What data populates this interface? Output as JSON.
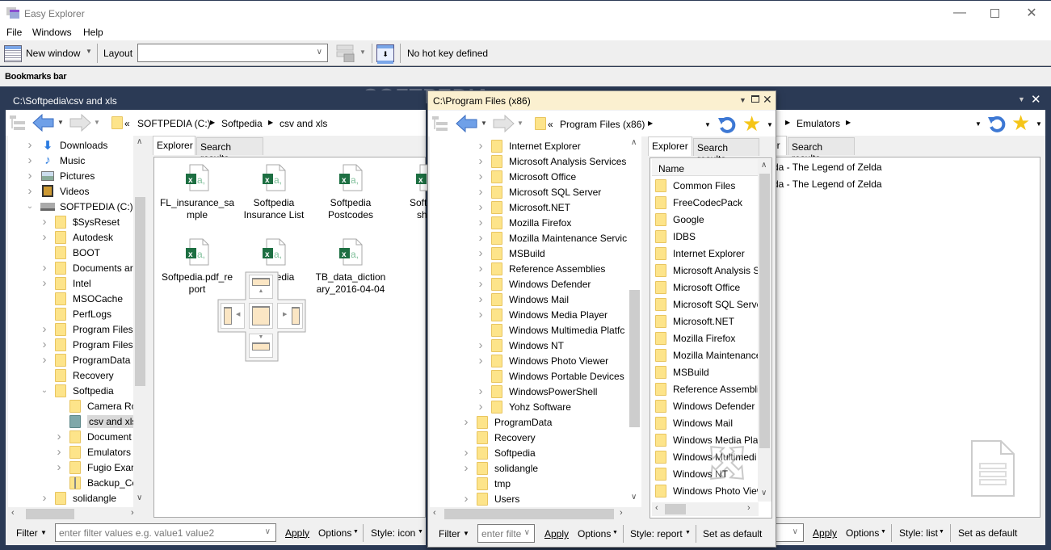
{
  "app": {
    "title": "Easy Explorer"
  },
  "menu": [
    "File",
    "Windows",
    "Help"
  ],
  "toolbar": {
    "new_window": "New window",
    "layout_label": "Layout",
    "layout_value": "",
    "hotkey": "No hot key defined"
  },
  "bookmarks_bar": "Bookmarks bar",
  "watermark": "SOFTPEDIA",
  "left_pane": {
    "title": "C:\\Softpedia\\csv and xls",
    "breadcrumb": [
      "«",
      "SOFTPEDIA (C:)",
      "Softpedia",
      "csv and xls"
    ],
    "tabs": [
      "Explorer",
      "Search results"
    ],
    "tree": [
      {
        "label": "Downloads",
        "level": 1,
        "expand": "collapsed",
        "icon": "download-icon"
      },
      {
        "label": "Music",
        "level": 1,
        "expand": "collapsed",
        "icon": "music-icon"
      },
      {
        "label": "Pictures",
        "level": 1,
        "expand": "collapsed",
        "icon": "pictures-icon"
      },
      {
        "label": "Videos",
        "level": 1,
        "expand": "collapsed",
        "icon": "videos-icon"
      },
      {
        "label": "SOFTPEDIA (C:)",
        "level": 1,
        "expand": "expanded",
        "icon": "drive-icon"
      },
      {
        "label": "$SysReset",
        "level": 2,
        "expand": "collapsed"
      },
      {
        "label": "Autodesk",
        "level": 2,
        "expand": "collapsed"
      },
      {
        "label": "BOOT",
        "level": 2,
        "expand": "none"
      },
      {
        "label": "Documents ar",
        "level": 2,
        "expand": "collapsed",
        "shortcut": true
      },
      {
        "label": "Intel",
        "level": 2,
        "expand": "collapsed"
      },
      {
        "label": "MSOCache",
        "level": 2,
        "expand": "none"
      },
      {
        "label": "PerfLogs",
        "level": 2,
        "expand": "none"
      },
      {
        "label": "Program Files",
        "level": 2,
        "expand": "collapsed"
      },
      {
        "label": "Program Files",
        "level": 2,
        "expand": "collapsed"
      },
      {
        "label": "ProgramData",
        "level": 2,
        "expand": "collapsed"
      },
      {
        "label": "Recovery",
        "level": 2,
        "expand": "none"
      },
      {
        "label": "Softpedia",
        "level": 2,
        "expand": "expanded"
      },
      {
        "label": "Camera Rc",
        "level": 3,
        "expand": "none"
      },
      {
        "label": "csv and xls",
        "level": 3,
        "expand": "none",
        "selected": true
      },
      {
        "label": "Document",
        "level": 3,
        "expand": "collapsed"
      },
      {
        "label": "Emulators",
        "level": 3,
        "expand": "collapsed"
      },
      {
        "label": "Fugio Exar",
        "level": 3,
        "expand": "collapsed"
      },
      {
        "label": "Backup_Cc",
        "level": 3,
        "expand": "none",
        "zip": true
      },
      {
        "label": "solidangle",
        "level": 2,
        "expand": "collapsed"
      }
    ],
    "files": [
      {
        "label1": "FL_insurance_sa",
        "label2": "mple"
      },
      {
        "label1": "Softpedia",
        "label2": "Insurance List"
      },
      {
        "label1": "Softpedia",
        "label2": "Postcodes"
      },
      {
        "label1": "Softpedi",
        "label2": "shee"
      },
      {
        "label1": "Softpedia.pdf_re",
        "label2": "port"
      },
      {
        "label1": "Softpedia",
        "label2": ""
      },
      {
        "label1": "TB_data_diction",
        "label2": "ary_2016-04-04"
      }
    ],
    "filter": {
      "label": "Filter",
      "placeholder": "enter filter values e.g. value1 value2",
      "apply": "Apply",
      "options": "Options",
      "style": "Style: icon"
    }
  },
  "middle_pane": {
    "title": "C:\\Program Files (x86)",
    "breadcrumb": [
      "«",
      "Program Files (x86)"
    ],
    "tabs": [
      "Explorer",
      "Search results"
    ],
    "tree": [
      {
        "label": "Internet Explorer",
        "level": 2,
        "expand": "collapsed"
      },
      {
        "label": "Microsoft Analysis Services",
        "level": 2,
        "expand": "collapsed"
      },
      {
        "label": "Microsoft Office",
        "level": 2,
        "expand": "collapsed"
      },
      {
        "label": "Microsoft SQL Server",
        "level": 2,
        "expand": "collapsed"
      },
      {
        "label": "Microsoft.NET",
        "level": 2,
        "expand": "collapsed"
      },
      {
        "label": "Mozilla Firefox",
        "level": 2,
        "expand": "collapsed"
      },
      {
        "label": "Mozilla Maintenance Servic",
        "level": 2,
        "expand": "collapsed"
      },
      {
        "label": "MSBuild",
        "level": 2,
        "expand": "collapsed"
      },
      {
        "label": "Reference Assemblies",
        "level": 2,
        "expand": "collapsed"
      },
      {
        "label": "Windows Defender",
        "level": 2,
        "expand": "collapsed"
      },
      {
        "label": "Windows Mail",
        "level": 2,
        "expand": "collapsed"
      },
      {
        "label": "Windows Media Player",
        "level": 2,
        "expand": "collapsed"
      },
      {
        "label": "Windows Multimedia Platfc",
        "level": 2,
        "expand": "none"
      },
      {
        "label": "Windows NT",
        "level": 2,
        "expand": "collapsed"
      },
      {
        "label": "Windows Photo Viewer",
        "level": 2,
        "expand": "collapsed"
      },
      {
        "label": "Windows Portable Devices",
        "level": 2,
        "expand": "none"
      },
      {
        "label": "WindowsPowerShell",
        "level": 2,
        "expand": "collapsed"
      },
      {
        "label": "Yohz Software",
        "level": 2,
        "expand": "collapsed"
      },
      {
        "label": "ProgramData",
        "level": 1,
        "expand": "collapsed"
      },
      {
        "label": "Recovery",
        "level": 1,
        "expand": "none"
      },
      {
        "label": "Softpedia",
        "level": 1,
        "expand": "collapsed"
      },
      {
        "label": "solidangle",
        "level": 1,
        "expand": "collapsed"
      },
      {
        "label": "tmp",
        "level": 1,
        "expand": "none"
      },
      {
        "label": "Users",
        "level": 1,
        "expand": "collapsed"
      }
    ],
    "list_header": "Name",
    "list": [
      "Common Files",
      "FreeCodecPack",
      "Google",
      "IDBS",
      "Internet Explorer",
      "Microsoft Analysis Se",
      "Microsoft Office",
      "Microsoft SQL Server",
      "Microsoft.NET",
      "Mozilla Firefox",
      "Mozilla Maintenance",
      "MSBuild",
      "Reference Assemblie",
      "Windows Defender",
      "Windows Mail",
      "Windows Media Play",
      "Windows Multimedi",
      "Windows NT",
      "Windows Photo View"
    ],
    "filter": {
      "label": "Filter",
      "placeholder": "enter filte",
      "apply": "Apply",
      "options": "Options",
      "style": "Style: report",
      "set_default": "Set as default"
    }
  },
  "right_pane": {
    "breadcrumb": [
      "Emulators"
    ],
    "tabs": [
      "er",
      "Search results"
    ],
    "list": [
      "da - The Legend of Zelda",
      "da - The Legend of Zelda"
    ],
    "filter": {
      "apply": "Apply",
      "options": "Options",
      "style": "Style: list",
      "set_default": "Set as default"
    }
  }
}
